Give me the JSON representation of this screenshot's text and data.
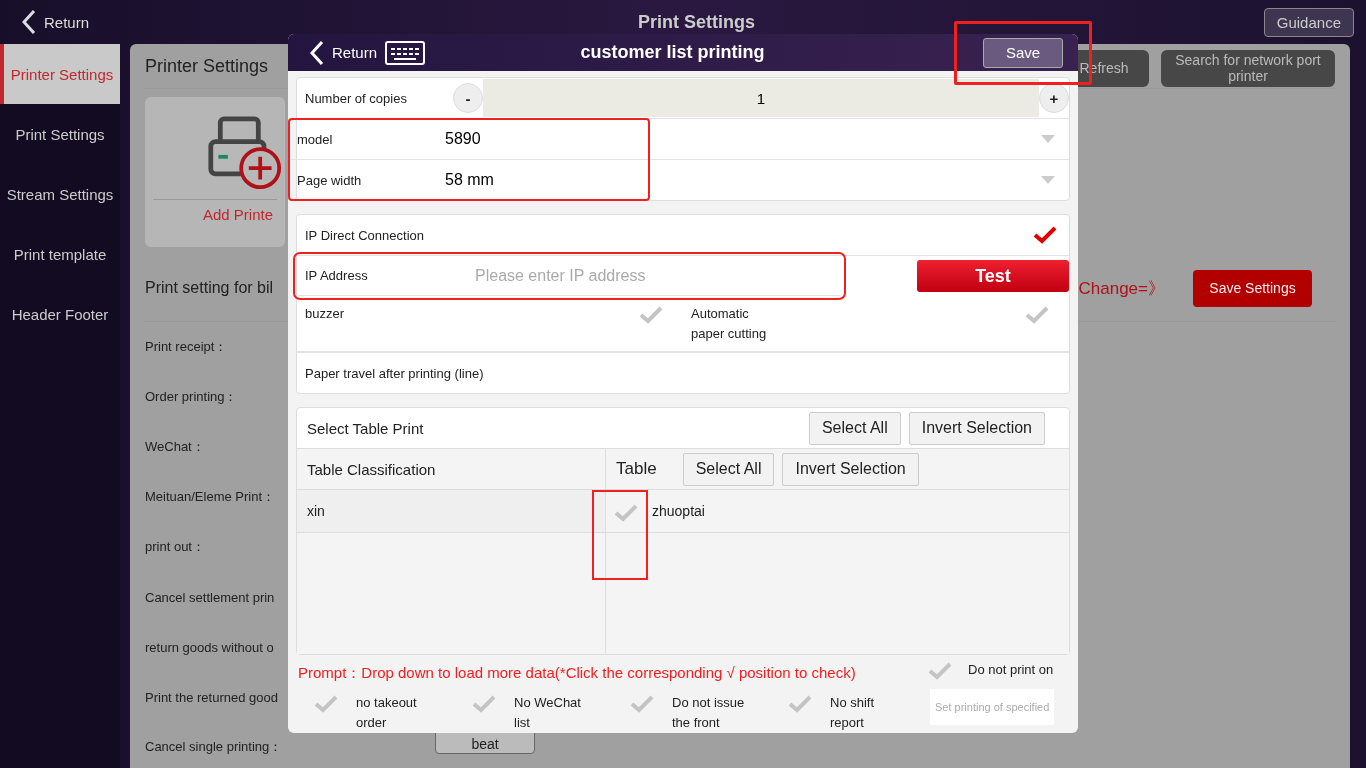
{
  "app": {
    "back": "Return",
    "title": "Print Settings",
    "guidance": "Guidance"
  },
  "sidebar": [
    {
      "label": "Printer Settings",
      "selected": true
    },
    {
      "label": "Print Settings",
      "selected": false
    },
    {
      "label": "Stream Settings",
      "selected": false
    },
    {
      "label": "Print template",
      "selected": false
    },
    {
      "label": "Header Footer",
      "selected": false
    }
  ],
  "printer_panel": {
    "title": "Printer Settings",
    "refresh": "Refresh",
    "search_network": "Search for network port printer",
    "add_printer": "Add Printe",
    "section_title": "Print setting for bil",
    "change_link": "Change=》",
    "save_settings": "Save Settings",
    "rows": [
      "Print receipt：",
      "Order printing：",
      "WeChat：",
      "Meituan/Eleme Print：",
      "print out：",
      "Cancel settlement prin",
      "return goods without o",
      "Print the returned good",
      "Cancel single printing："
    ],
    "kitchen_button": "beat"
  },
  "dialog": {
    "back": "Return",
    "title": "customer list printing",
    "save": {
      "label": "Save",
      "highlighted": true
    },
    "copies": {
      "label": "Number of copies",
      "minus": "-",
      "value": "1",
      "plus": "+"
    },
    "printer_group": {
      "highlighted": true,
      "rows": [
        {
          "label": "model",
          "value": "5890"
        },
        {
          "label": "Page width",
          "value": "58 mm"
        }
      ]
    },
    "ip_direct": {
      "label": "IP Direct Connection",
      "checked": true
    },
    "ip_address": {
      "label": "IP Address",
      "placeholder": "Please enter IP address",
      "test": "Test",
      "highlighted": true
    },
    "toggles": [
      {
        "label": "buzzer",
        "checked": false
      },
      {
        "label": "Automatic paper cutting",
        "checked": false
      }
    ],
    "paper_travel": {
      "label": "Paper travel after printing (line)"
    },
    "table_print": {
      "title": "Select Table Print",
      "select_all": "Select All",
      "invert": "Invert Selection",
      "classification_header": "Table Classification",
      "table_header": "Table",
      "table_select_all": "Select All",
      "table_invert": "Invert Selection",
      "classifications": [
        {
          "label": "xin",
          "selected": true
        }
      ],
      "tables": [
        {
          "label": "zhuoptai",
          "checked": false,
          "highlighted": true
        }
      ]
    },
    "prompt": "Prompt：Drop down to load more data(*Click the corresponding √ position to check)",
    "options": [
      {
        "label": "Do not print on",
        "checked": false
      },
      {
        "label": "no takeout order",
        "checked": false
      },
      {
        "label": "No WeChat list",
        "checked": false
      },
      {
        "label": "Do not issue the front",
        "checked": false
      },
      {
        "label": "No shift report",
        "checked": false
      }
    ],
    "specified_note": "Set printing of specified"
  }
}
